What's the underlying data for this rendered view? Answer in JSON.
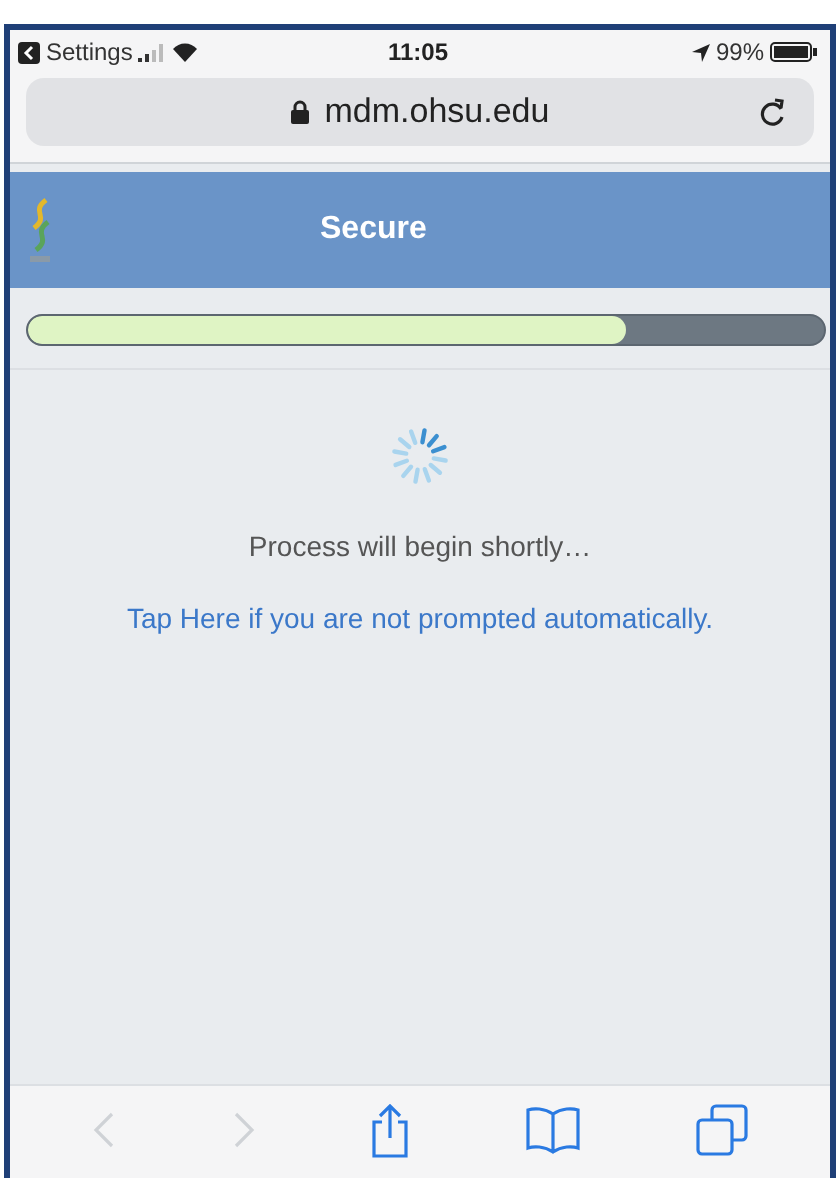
{
  "status_bar": {
    "back_label": "Settings",
    "time": "11:05",
    "battery": "99%"
  },
  "address_bar": {
    "url": "mdm.ohsu.edu"
  },
  "header": {
    "title": "Secure"
  },
  "progress": {
    "level": 0.75
  },
  "content": {
    "message": "Process will begin shortly…",
    "link": "Tap Here if you are not prompted automatically."
  },
  "toolbar": {
    "back_disabled": true,
    "forward_disabled": true
  }
}
